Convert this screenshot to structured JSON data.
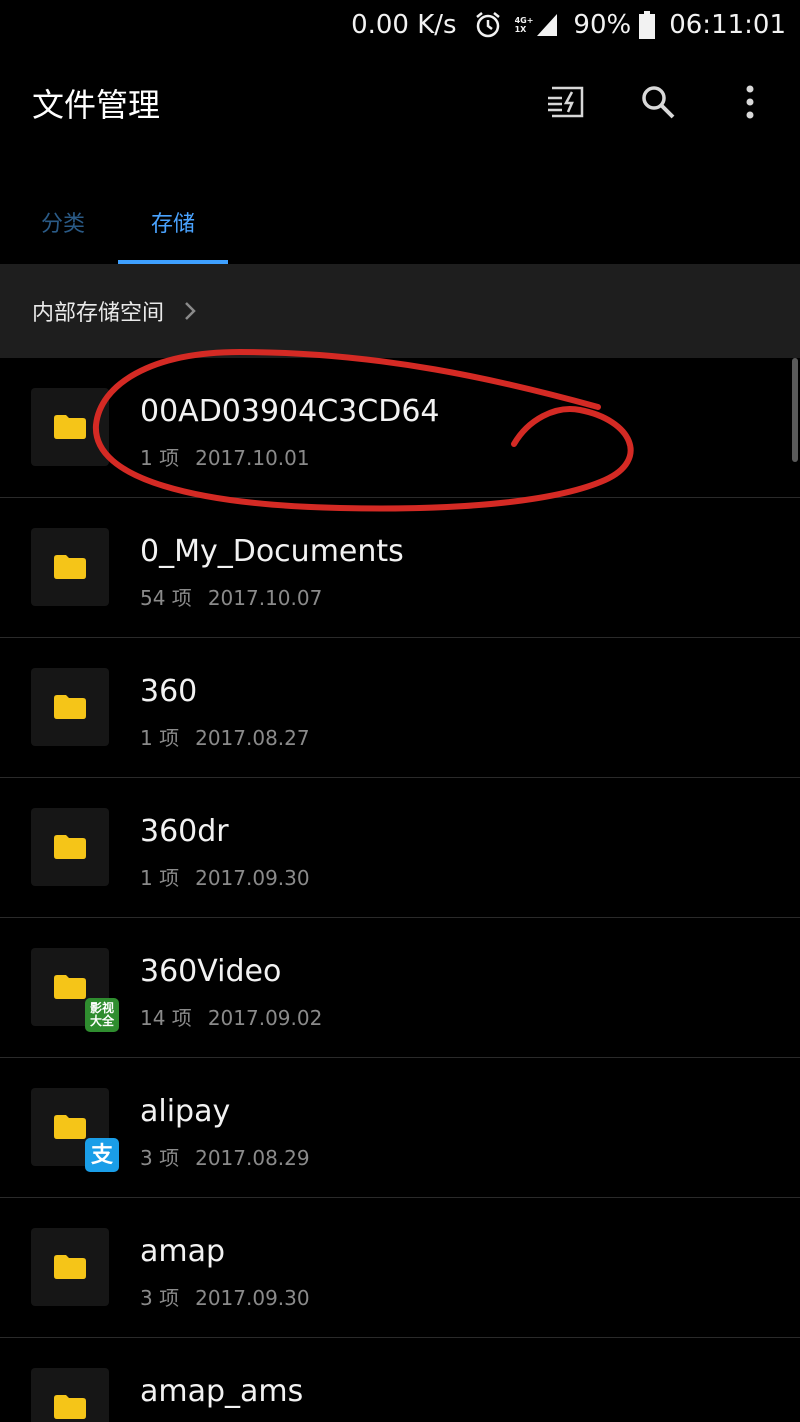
{
  "status_bar": {
    "speed": "0.00 K/s",
    "network_top": "4G+",
    "network_bottom": "1X",
    "battery_pct": "90%",
    "time": "06:11:01"
  },
  "app_bar": {
    "title": "文件管理"
  },
  "tabs": [
    {
      "label": "分类"
    },
    {
      "label": "存储"
    }
  ],
  "breadcrumb": {
    "label": "内部存储空间"
  },
  "files": [
    {
      "name": "00AD03904C3CD64",
      "count": "1 项",
      "date": "2017.10.01"
    },
    {
      "name": "0_My_Documents",
      "count": "54 项",
      "date": "2017.10.07"
    },
    {
      "name": "360",
      "count": "1 项",
      "date": "2017.08.27"
    },
    {
      "name": "360dr",
      "count": "1 项",
      "date": "2017.09.30"
    },
    {
      "name": "360Video",
      "count": "14 项",
      "date": "2017.09.02",
      "badge": "影视\n大全"
    },
    {
      "name": "alipay",
      "count": "3 项",
      "date": "2017.08.29",
      "badge": "支"
    },
    {
      "name": "amap",
      "count": "3 项",
      "date": "2017.09.30"
    },
    {
      "name": "amap_ams",
      "count": "",
      "date": ""
    }
  ],
  "colors": {
    "accent": "#3ea0ff",
    "folder": "#f5c518",
    "annotation": "#d42a24"
  }
}
